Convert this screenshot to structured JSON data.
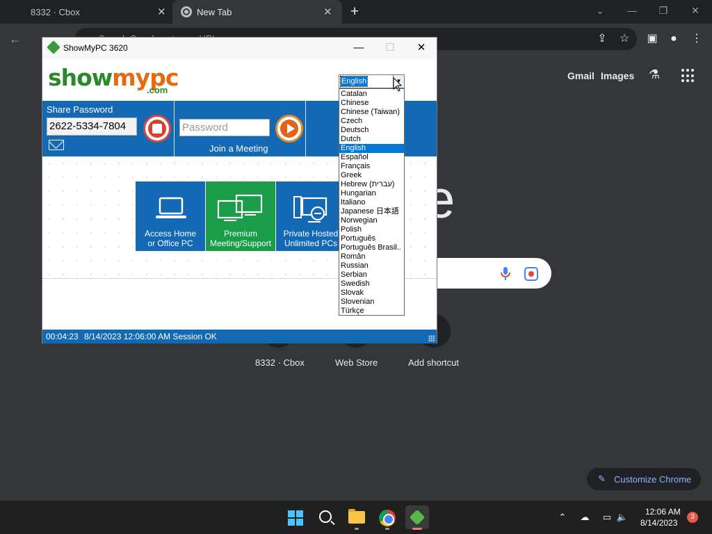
{
  "browser": {
    "tabs": [
      {
        "title": "8332 · Cbox"
      },
      {
        "title": "New Tab"
      }
    ],
    "new_tab_symbol": "+",
    "close_symbol": "✕",
    "omnibox_placeholder": "Search Google or type a URL",
    "window_controls": {
      "chevron": "⌄",
      "minimize": "—",
      "restore": "❐",
      "close": "✕"
    }
  },
  "ntp": {
    "gmail": "Gmail",
    "images": "Images",
    "logo_fragment": "e",
    "shortcuts": [
      "8332 · Cbox",
      "Web Store",
      "Add shortcut"
    ],
    "customize": "Customize Chrome"
  },
  "showmypc": {
    "title": "ShowMyPC 3620",
    "logo": {
      "part1": "show",
      "part2": "mypc",
      "suffix": ".com"
    },
    "language": {
      "selected": "English",
      "options": [
        "Catalan",
        "Chinese",
        "Chinese (Taiwan)",
        "Czech",
        "Deutsch",
        "Dutch",
        "English",
        "Español",
        "Français",
        "Greek",
        "Hebrew (עברית)",
        "Hungarian",
        "Italiano",
        "Japanese 日本語",
        "Norwegian",
        "Polish",
        "Português",
        "Português Brasil..",
        "Român",
        "Russian",
        "Serbian",
        "Swedish",
        "Slovak",
        "Slovenian",
        "Türkçe"
      ]
    },
    "share": {
      "label": "Share Password",
      "password": "2622-5334-7804"
    },
    "join": {
      "placeholder": "Password",
      "label": "Join a Meeting"
    },
    "tiles": [
      {
        "line1": "Access Home",
        "line2": "or Office PC"
      },
      {
        "line1": "Premium",
        "line2": "Meeting/Support"
      },
      {
        "line1": "Private Hosted",
        "line2": "Unlimited PCs"
      }
    ],
    "status": {
      "elapsed": "00:04:23",
      "message": "8/14/2023 12:06:00 AM Session OK"
    }
  },
  "taskbar": {
    "time": "12:06 AM",
    "date": "8/14/2023",
    "notifications": "3"
  },
  "colors": {
    "chrome_bg": "#35363a",
    "smpc_blue": "#1469b5",
    "smpc_green": "#1a9c48",
    "selection": "#0078d7"
  }
}
